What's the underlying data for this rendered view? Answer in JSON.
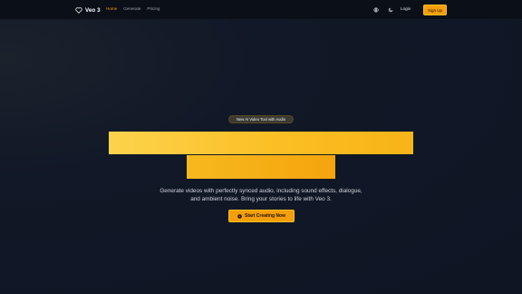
{
  "brand": {
    "name": "Veo 3",
    "logo_icon": "heart-outline-icon"
  },
  "nav": {
    "links": [
      {
        "label": "Home",
        "active": true
      },
      {
        "label": "Generate",
        "active": false
      },
      {
        "label": "Pricing",
        "active": false
      }
    ],
    "language_icon": "globe-icon",
    "theme_icon": "moon-icon",
    "login_label": "Login",
    "signup_label": "Sign Up"
  },
  "hero": {
    "badge": "New AI Video Tool with Audio",
    "description_line1": "Generate videos with perfectly synced audio, including sound effects, dialogue,",
    "description_line2": "and ambient noise. Bring your stories to life with Veo 3.",
    "cta_label": "Start Creating Now",
    "cta_icon": "play-circle-icon"
  },
  "colors": {
    "accent": "#f59e0b",
    "accent_light": "#fcd34d",
    "background": "#0f1726",
    "nav_background": "#0b0f17"
  }
}
